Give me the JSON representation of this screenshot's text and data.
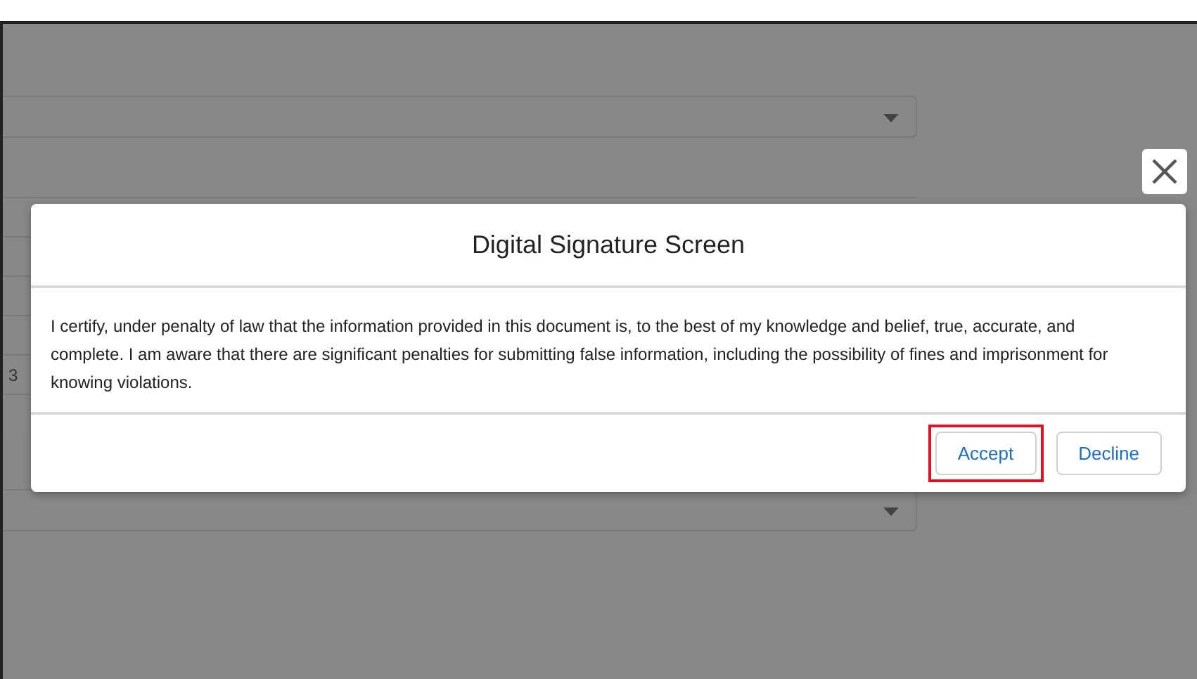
{
  "background_form": {
    "fields": [
      {
        "kind": "dropdown"
      },
      {
        "kind": "text"
      },
      {
        "kind": "text"
      },
      {
        "kind": "text"
      },
      {
        "kind": "text"
      },
      {
        "kind": "label",
        "label": "3"
      },
      {
        "kind": "text"
      },
      {
        "kind": "gap"
      },
      {
        "kind": "dropdown"
      }
    ]
  },
  "dialog": {
    "title": "Digital Signature Screen",
    "message": "I certify, under penalty of law that the information provided in this document is, to the best of my knowledge and belief, true, accurate, and complete. I am aware that there are significant penalties for submitting false information, including the possibility of fines and imprisonment for knowing violations.",
    "buttons": [
      {
        "label": "Accept",
        "highlighted": true
      },
      {
        "label": "Decline",
        "highlighted": false
      }
    ]
  }
}
